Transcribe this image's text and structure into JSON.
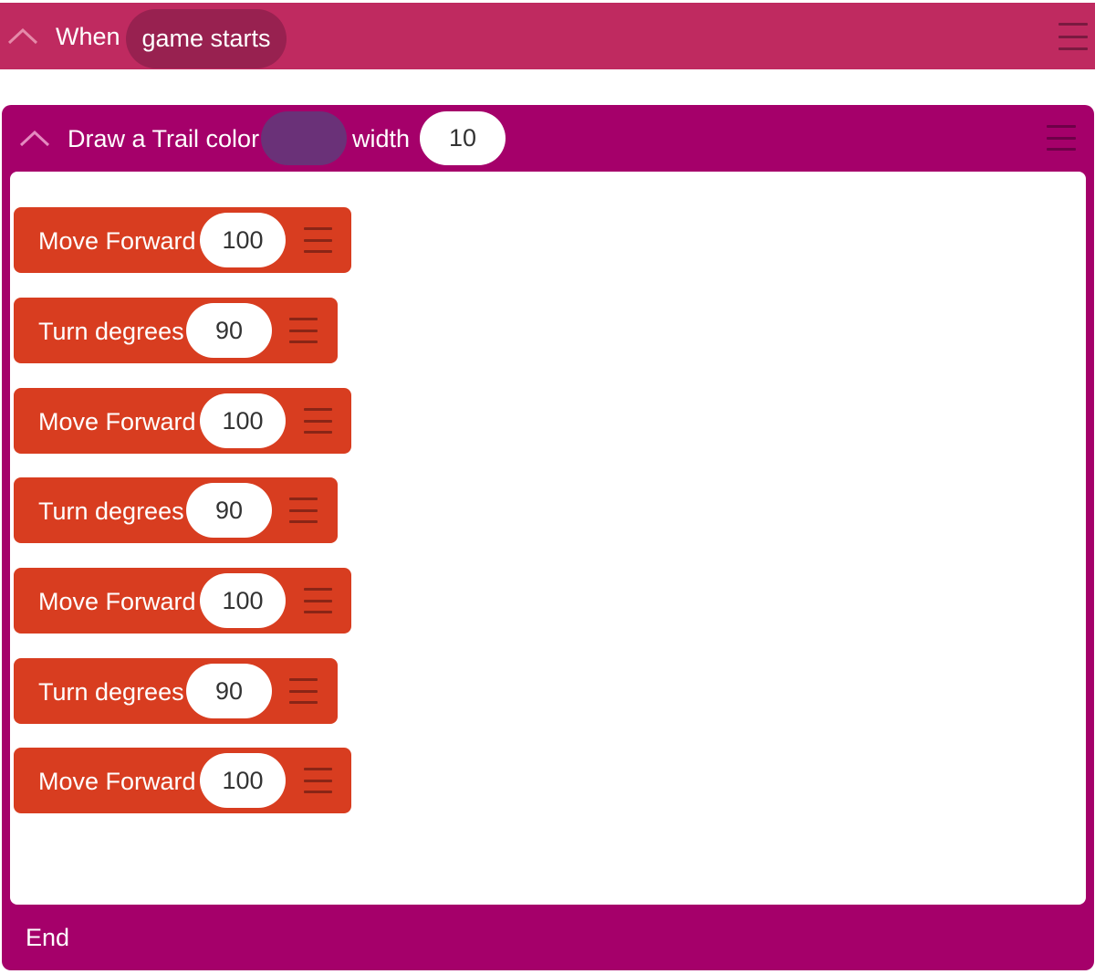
{
  "event_block": {
    "label": "When",
    "event": "game starts",
    "color": "#bf2a60",
    "icons": [
      "chevron-up-icon",
      "menu-icon"
    ]
  },
  "draw_block": {
    "label": "Draw a Trail color",
    "trail_color": "#6a3178",
    "width_label": "width",
    "width_value": "10",
    "end_label": "End",
    "color": "#a5006a",
    "icons": [
      "chevron-up-icon",
      "menu-icon"
    ]
  },
  "commands": [
    {
      "label": "Move Forward",
      "value": "100"
    },
    {
      "label": "Turn degrees",
      "value": "90"
    },
    {
      "label": "Move Forward",
      "value": "100"
    },
    {
      "label": "Turn degrees",
      "value": "90"
    },
    {
      "label": "Move Forward",
      "value": "100"
    },
    {
      "label": "Turn degrees",
      "value": "90"
    },
    {
      "label": "Move Forward",
      "value": "100"
    }
  ],
  "command_color": "#d83d20"
}
